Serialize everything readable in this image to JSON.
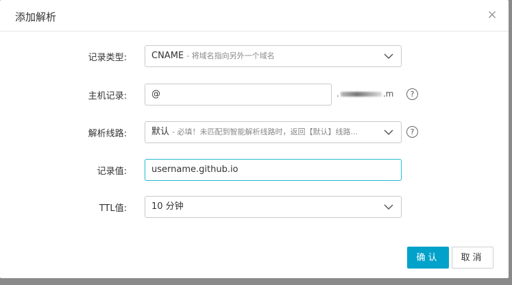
{
  "dialog": {
    "title": "添加解析",
    "close_glyph": "×"
  },
  "record_type": {
    "label": "记录类型:",
    "value": "CNAME",
    "hint": "- 将域名指向另外一个域名"
  },
  "host_record": {
    "label": "主机记录:",
    "value": "@",
    "domain_suffix_start": ".",
    "domain_suffix_end": ".m"
  },
  "resolve_line": {
    "label": "解析线路:",
    "value": "默认",
    "hint": "- 必填！未匹配到智能解析线路时，返回【默认】线路..."
  },
  "record_value": {
    "label": "记录值:",
    "value": "username.github.io"
  },
  "ttl": {
    "label": "TTL值:",
    "value": "10 分钟"
  },
  "buttons": {
    "confirm": "确认",
    "cancel": "取消"
  },
  "help_glyph": "?",
  "colors": {
    "primary": "#00a2ca",
    "focus_border": "#27b8cf"
  }
}
